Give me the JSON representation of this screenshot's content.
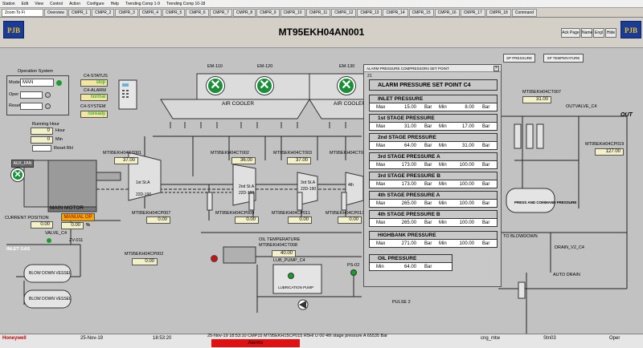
{
  "menu": [
    "Station",
    "Edit",
    "View",
    "Control",
    "Action",
    "Configure",
    "Help",
    "Trending Comp 1-9",
    "Trending Comp 10-18"
  ],
  "tabs": {
    "zoom": "Zoom To Fi",
    "items": [
      "Overview",
      "CMPR_1",
      "CMPR_2",
      "CMPR_3",
      "CMPR_4",
      "CMPR_5",
      "CMPR_6",
      "CMPR_7",
      "CMPR_8",
      "CMPR_9",
      "CMPR_10",
      "CMPR_11",
      "CMPR_12",
      "CMPR_13",
      "CMPR_14",
      "CMPR_15",
      "CMPR_16",
      "CMPR_17",
      "CMPR_18",
      "Command"
    ]
  },
  "header": {
    "logo": "PJB",
    "title": "MT95EKH04AN001",
    "buttons": [
      "Ack Page",
      "Name",
      "Engl",
      "Hide"
    ]
  },
  "operation": {
    "title": "Operation System",
    "mode_label": "Mode",
    "mode_value": "MAN",
    "oper_label": "Oper",
    "reset_label": "Reset",
    "c4_status_label": "C4-STATUS",
    "c4_status": "stop",
    "c4_alarm_label": "C4-ALARM",
    "c4_alarm": "normal",
    "c4_system_label": "C4-SYSTEM",
    "c4_system": "noready"
  },
  "running_hour": {
    "title": "Running Hour",
    "hour": "0",
    "hour_label": "Hour",
    "min": "0",
    "min_label": "Min",
    "reset_label": "Reset RH"
  },
  "cooler": {
    "em": [
      "EM-110",
      "EM-120",
      "EM-130"
    ],
    "label": "AIR COOLER",
    "label2": "AIR COOLER"
  },
  "motor": {
    "aux_fan": "AUX_FAN",
    "label": "MAIN MOTOR"
  },
  "position": {
    "label": "CURRENT POSITION",
    "value": "0.00"
  },
  "manual": {
    "label": "MANUAL OP",
    "value": "0.00",
    "unit": "%"
  },
  "valve_c4": "VALVE_C4",
  "zv": "ZV-011",
  "inlet": "INLET GAS",
  "blowdown": [
    "BLOW DOWN VESSEL",
    "BLOW DOWN VESSEL"
  ],
  "stages": [
    {
      "tag": "MT95EKH04CT001",
      "value": "37.00",
      "s1": "1st St.A",
      "s2": "22D-190"
    },
    {
      "tag": "MT95EKH04CT002",
      "value": "36.00",
      "s1": "2nd St.A",
      "s2": "22D-190"
    },
    {
      "tag": "MT95EKH04CT003",
      "value": "37.00",
      "s1": "3rd St.A",
      "s2": "22D-190"
    },
    {
      "tag": "MT95EKH04CT004",
      "value": "",
      "s1": "4th",
      "s2": ""
    }
  ],
  "pressures": [
    {
      "tag": "MT95EKH04CP007",
      "value": "0.00"
    },
    {
      "tag": "MT95EKH04CP009",
      "value": "0.00"
    },
    {
      "tag": "MT95EKH04CP011",
      "value": "0.00"
    },
    {
      "tag": "MT95EKH04CP013",
      "value": "0.00"
    }
  ],
  "cp002": {
    "tag": "MT95EKH04CP002",
    "value": "0.00"
  },
  "oil_temp": {
    "label": "OIL TEMPERATURE",
    "tag": "MT95EKH04CT008",
    "value": "40.00"
  },
  "lub": {
    "pump": "LUB_PUMP_C4",
    "label": "LUBRICATION PUMP",
    "ps": "PS-02"
  },
  "pulse": "PULSE 2",
  "right": {
    "sp_pressure": "SP PRESSURE",
    "sp_temperature": "SP TEMPERATURE",
    "ct007_tag": "MT95EKH04CT007",
    "ct007_value": "31.00",
    "outvalve": "OUTVALVE_C4",
    "out": "OUT",
    "cp019_tag": "MT95EKH04CP019",
    "cp019_value": "127.00",
    "press_cmd": "PRESS AND COMMAND PRESSURE",
    "to_blowdown": "TO BLOWDOWN",
    "drain": "DRAIN_V2_C4",
    "auto_drain": "AUTO DRAIN"
  },
  "popup": {
    "title": "ALARM PRESSURE COMPRESSOR4 SET POINT",
    "sub": "21",
    "heading": "ALARM PRESSURE SET POINT C4",
    "sections": [
      {
        "name": "INLET PRESSURE",
        "max": "15.00",
        "min": "8.00"
      },
      {
        "name": "1st STAGE PRESSURE",
        "max": "31.00",
        "min": "17.00"
      },
      {
        "name": "2nd STAGE PRESSURE",
        "max": "64.00",
        "min": "31.00"
      },
      {
        "name": "3rd STAGE PRESSURE A",
        "max": "173.00",
        "min": "100.00"
      },
      {
        "name": "3rd STAGE PRESSURE B",
        "max": "173.00",
        "min": "100.00"
      },
      {
        "name": "4th STAGE PRESSURE A",
        "max": "265.00",
        "min": "100.00"
      },
      {
        "name": "4th STAGE PRESSURE B",
        "max": "265.00",
        "min": "100.00"
      },
      {
        "name": "HIGHBANK PRESSURE",
        "max": "271.00",
        "min": "100.00"
      }
    ],
    "oil": {
      "name": "OIL PRESSURE",
      "min": "64.00"
    },
    "max_label": "Max",
    "min_label": "Min",
    "unit": "Bar"
  },
  "status": {
    "brand": "Honeywell",
    "date": "25-Nov-19",
    "time": "18:53:20",
    "alarm_msg": "25-Nov-19  18:53:10  CMP15  MT95EKH15CP015  R5HI  U 00 4th stage pressure A  65535  Bar",
    "alarms": "Alarms",
    "user": "cng_mtw",
    "station": "Stn03",
    "mode": "Oper"
  },
  "colors": {
    "green_led": "#1a9e2a",
    "status_yellow": "#f3e7a0",
    "alarm_red": "#e21010",
    "brand": "#1a3b96"
  }
}
